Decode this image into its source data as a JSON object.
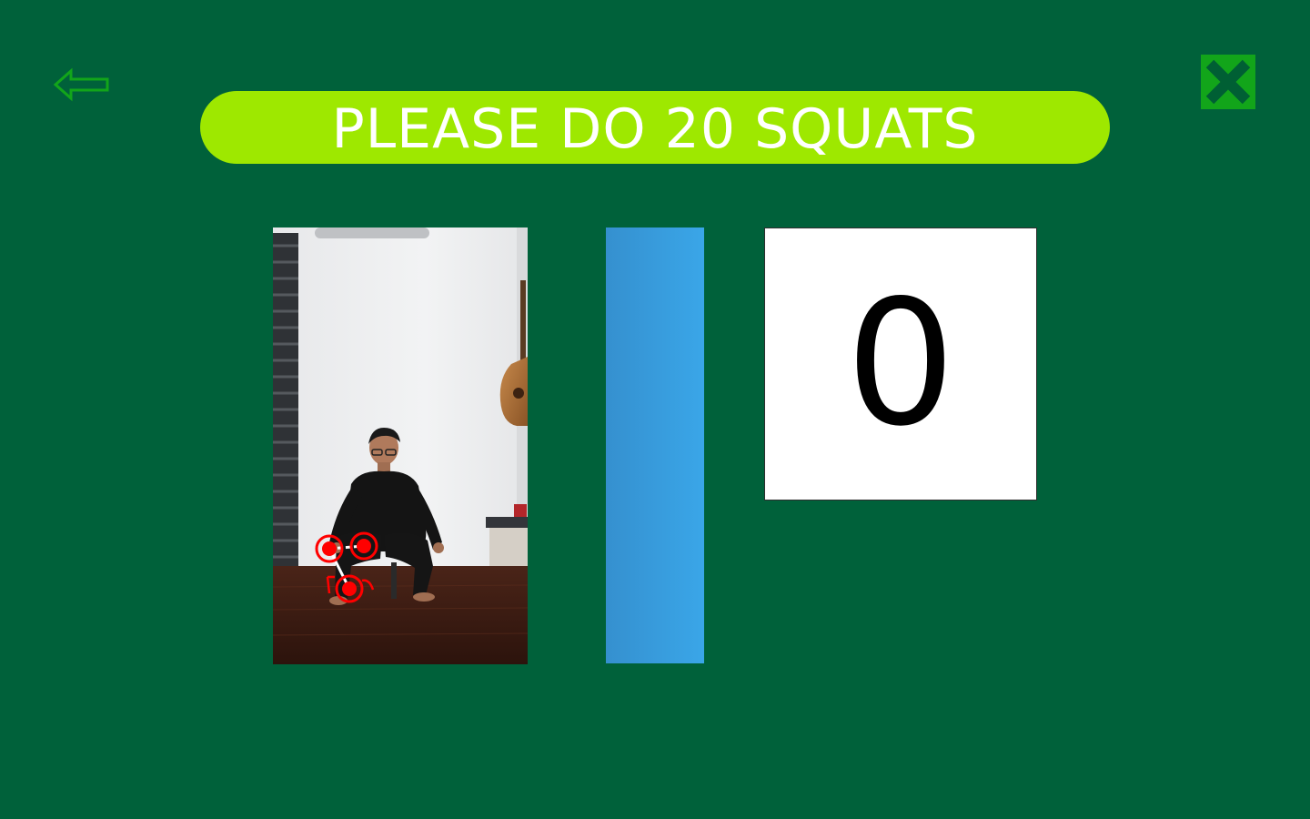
{
  "header": {
    "instruction": "PLEASE DO 20 SQUATS"
  },
  "toolbar": {
    "back_icon": "left-arrow-outline-icon",
    "close_icon": "close-x-icon"
  },
  "exercise": {
    "rep_count": "0",
    "progress_fraction": 1.0
  },
  "colors": {
    "background": "#00613a",
    "banner": "#9ee800",
    "banner_text": "#ffffff",
    "close_button": "#12a51a",
    "progress_fill": "#3aa6e8",
    "pose_keypoint": "#ff0000",
    "pose_limb": "#ffffff"
  }
}
